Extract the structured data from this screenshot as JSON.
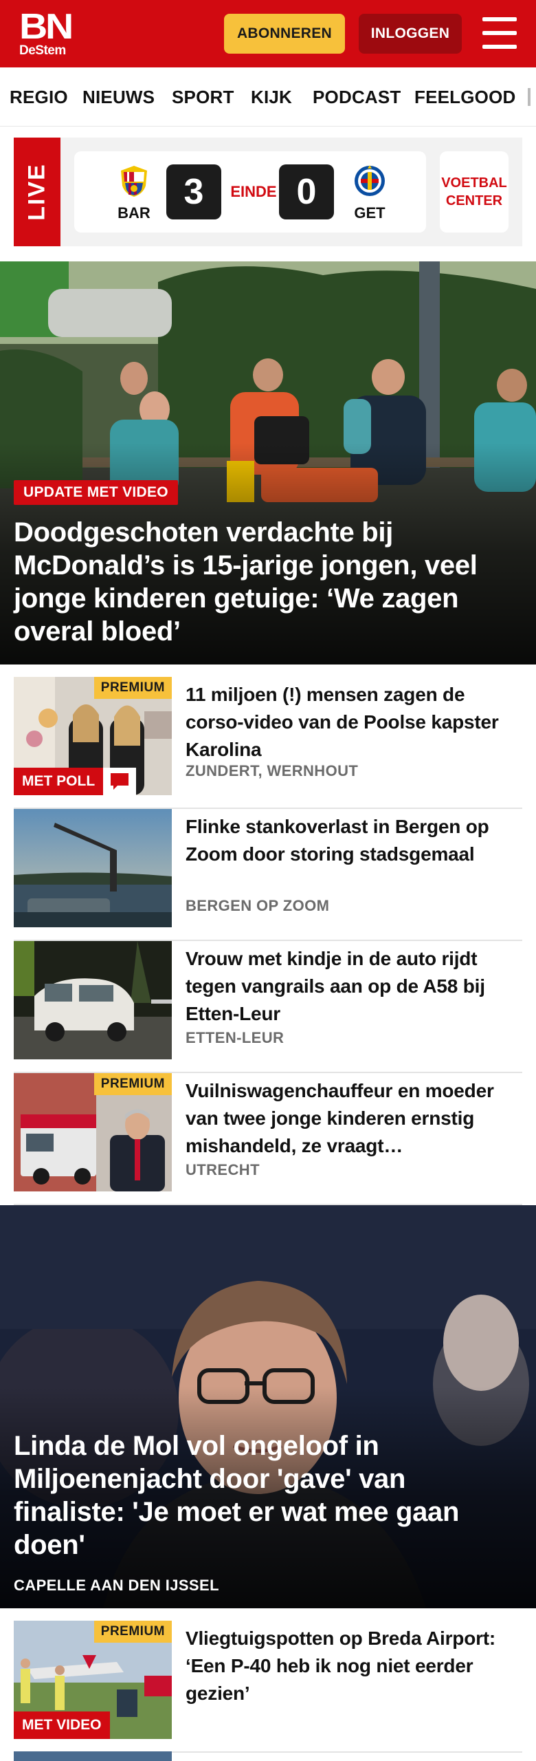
{
  "header": {
    "logo_main": "BN",
    "logo_sub": "DeStem",
    "subscribe_label": "ABONNEREN",
    "login_label": "INLOGGEN"
  },
  "nav": {
    "items": [
      "REGIO",
      "NIEUWS",
      "SPORT",
      "KIJK",
      "PODCAST",
      "FEELGOOD"
    ]
  },
  "live": {
    "badge": "LIVE",
    "home_team": "BAR",
    "home_score": "3",
    "status": "EINDE",
    "away_score": "0",
    "away_team": "GET",
    "voetbalcenter_line1": "VOETBAL",
    "voetbalcenter_line2": "CENTER"
  },
  "hero": {
    "tag": "UPDATE MET VIDEO",
    "title": "Doodgeschoten verdachte bij McDonald’s is 15-jarige jongen, veel jonge kinderen getuige: ‘We zagen overal bloed’"
  },
  "articles": [
    {
      "title": "11 miljoen (!) mensen zagen de corso-video van de Poolse kapster Karolina",
      "location": "ZUNDERT, WERNHOUT",
      "premium": "PREMIUM",
      "overlay": "MET POLL"
    },
    {
      "title": "Flinke stankoverlast in Bergen op Zoom door storing stadsgemaal",
      "location": "BERGEN OP ZOOM"
    },
    {
      "title": "Vrouw met kindje in de auto rijdt tegen vangrails aan op de A58 bij Etten-Leur",
      "location": "ETTEN-LEUR"
    },
    {
      "title": "Vuilniswagenchauffeur en moeder van twee jonge kinderen ernstig mishandeld, ze vraagt…",
      "location": "UTRECHT",
      "premium": "PREMIUM"
    }
  ],
  "hero2": {
    "title": "Linda de Mol vol ongeloof in Miljoenenjacht door 'gave' van finaliste: 'Je moet er wat mee gaan doen'",
    "location": "CAPELLE AAN DEN IJSSEL"
  },
  "article5": {
    "title": "Vliegtuigspotten op Breda Airport: ‘Een P-40 heb ik nog niet eerder gezien’",
    "premium": "PREMIUM",
    "overlay": "MET VIDEO"
  },
  "colors": {
    "brand_red": "#d10a11",
    "premium_yellow": "#f7c13b",
    "login_dark_red": "#9d0a0f"
  }
}
